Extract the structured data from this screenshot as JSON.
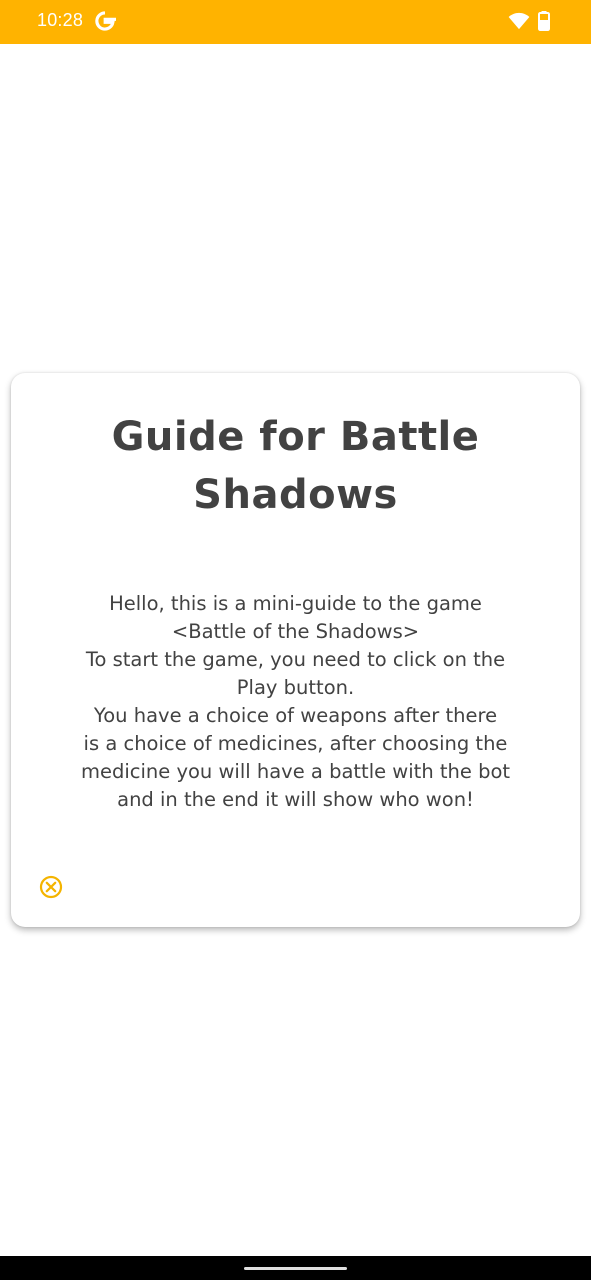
{
  "status_bar": {
    "time": "10:28",
    "background_color": "#FFB300",
    "icons": [
      "google-g-icon",
      "wifi-icon",
      "battery-icon"
    ]
  },
  "dialog": {
    "title": "Guide for Battle\nShadows",
    "body": "Hello, this is a mini-guide to the game\n<Battle of the Shadows>\nTo start the game, you need to click on the\nPlay button.\nYou have a choice of weapons after there\nis a choice of medicines, after choosing the\nmedicine you will have a battle with the bot\nand in the end it will show who won!",
    "close_icon": "close-circle-icon",
    "accent_color": "#F4B400"
  }
}
